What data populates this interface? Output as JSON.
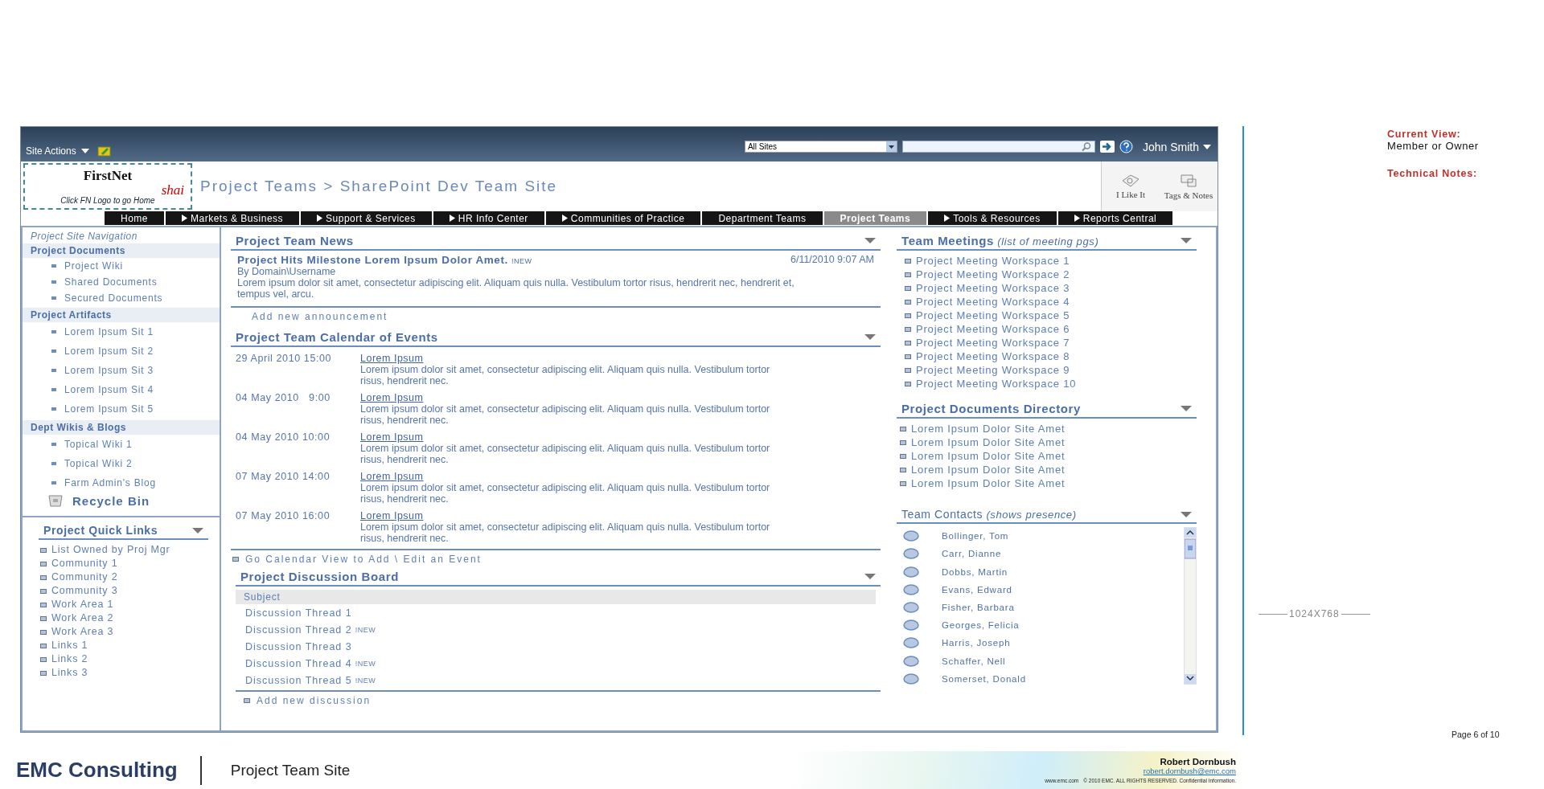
{
  "top_bar": {
    "site_actions": "Site Actions",
    "scope_select": "All Sites",
    "user": "John Smith"
  },
  "logo": {
    "brand": "FirstNet",
    "sub": "shai",
    "caption": "Click FN Logo to go Home"
  },
  "breadcrumb": "Project Teams > SharePoint Dev Team Site",
  "social": [
    {
      "kind": "like",
      "label": "I Like It"
    },
    {
      "kind": "tags",
      "label": "Tags & Notes"
    }
  ],
  "nav_tabs": [
    {
      "label": "Home",
      "arrow": false,
      "selected": false
    },
    {
      "label": "Markets & Business",
      "arrow": true,
      "selected": false
    },
    {
      "label": "Support & Services",
      "arrow": true,
      "selected": false
    },
    {
      "label": "HR Info Center",
      "arrow": true,
      "selected": false
    },
    {
      "label": "Communities of Practice",
      "arrow": true,
      "selected": false
    },
    {
      "label": "Department Teams",
      "arrow": false,
      "selected": false
    },
    {
      "label": "Project Teams",
      "arrow": false,
      "selected": true
    },
    {
      "label": "Tools & Resources",
      "arrow": true,
      "selected": false
    },
    {
      "label": "Reports Central",
      "arrow": true,
      "selected": false
    }
  ],
  "left_nav": {
    "title": "Project Site Navigation",
    "groups": [
      {
        "heading": "Project Documents",
        "items": [
          "Project Wiki",
          "Shared Documents",
          "Secured Documents"
        ]
      },
      {
        "heading": "Project Artifacts",
        "items": [
          "Lorem Ipsum Sit 1",
          "Lorem Ipsum Sit 2",
          "Lorem Ipsum Sit 3",
          "Lorem Ipsum Sit 4",
          "Lorem Ipsum Sit 5"
        ]
      },
      {
        "heading": "Dept Wikis & Blogs",
        "items": [
          "Topical Wiki 1",
          "Topical Wiki 2",
          "Farm Admin's Blog"
        ]
      }
    ],
    "recycle_bin": "Recycle Bin"
  },
  "quick_links": {
    "title": "Project Quick Links",
    "items": [
      "List Owned by Proj Mgr",
      "Community 1",
      "Community 2",
      "Community 3",
      "Work Area 1",
      "Work Area 2",
      "Work Area 3",
      "Links 1",
      "Links 2",
      "Links 3"
    ]
  },
  "news": {
    "title": "Project Team News",
    "items": [
      {
        "headline": "Project Hits Milestone Lorem Ipsum Dolor Amet.",
        "badge": "!NEW",
        "date": "6/11/2010 9:07 AM",
        "author": "By Domain\\Username",
        "body": "Lorem ipsum dolor sit amet, consectetur adipiscing elit. Aliquam quis nulla. Vestibulum tortor risus, hendrerit nec, hendrerit et, tempus vel, arcu."
      }
    ],
    "add": "Add new announcement"
  },
  "calendar": {
    "title": "Project Team Calendar of Events",
    "events": [
      {
        "date": "29 April 2010 15:00",
        "title": "Lorem Ipsum",
        "text": "Lorem ipsum dolor sit amet, consectetur adipiscing elit. Aliquam quis nulla. Vestibulum tortor risus, hendrerit nec."
      },
      {
        "date": "04 May 2010   9:00",
        "title": "Lorem Ipsum",
        "text": "Lorem ipsum dolor sit amet, consectetur adipiscing elit. Aliquam quis nulla. Vestibulum tortor risus, hendrerit nec."
      },
      {
        "date": "04 May 2010 10:00",
        "title": "Lorem Ipsum",
        "text": "Lorem ipsum dolor sit amet, consectetur adipiscing elit. Aliquam quis nulla. Vestibulum tortor risus, hendrerit nec."
      },
      {
        "date": "07 May 2010 14:00",
        "title": "Lorem Ipsum",
        "text": "Lorem ipsum dolor sit amet, consectetur adipiscing elit. Aliquam quis nulla. Vestibulum tortor risus, hendrerit nec."
      },
      {
        "date": "07 May 2010 16:00",
        "title": "Lorem Ipsum",
        "text": "Lorem ipsum dolor sit amet, consectetur adipiscing elit. Aliquam quis nulla. Vestibulum tortor risus, hendrerit nec."
      }
    ],
    "link": "Go Calendar View to Add \\ Edit an Event"
  },
  "discussion": {
    "title": "Project Discussion Board",
    "column": "Subject",
    "threads": [
      {
        "subject": "Discussion Thread 1"
      },
      {
        "subject": "Discussion Thread 2",
        "badge": "!NEW"
      },
      {
        "subject": "Discussion Thread 3"
      },
      {
        "subject": "Discussion Thread 4",
        "badge": "!NEW"
      },
      {
        "subject": "Discussion Thread 5",
        "badge": "!NEW"
      }
    ],
    "add": "Add new discussion"
  },
  "meetings": {
    "title": "Team Meetings",
    "note": "(list of meeting pgs)",
    "items": [
      "Project Meeting Workspace 1",
      "Project Meeting Workspace 2",
      "Project Meeting Workspace 3",
      "Project Meeting Workspace 4",
      "Project Meeting Workspace 5",
      "Project Meeting Workspace 6",
      "Project Meeting Workspace 7",
      "Project Meeting Workspace 8",
      "Project Meeting Workspace 9",
      "Project Meeting Workspace 10"
    ]
  },
  "documents": {
    "title": "Project Documents Directory",
    "items": [
      "Lorem Ipsum Dolor Site Amet",
      "Lorem Ipsum Dolor Site Amet",
      "Lorem Ipsum Dolor Site Amet",
      "Lorem Ipsum Dolor Site Amet",
      "Lorem Ipsum Dolor Site Amet"
    ]
  },
  "contacts": {
    "title": "Team Contacts",
    "note": "(shows presence)",
    "people": [
      "Bollinger, Tom",
      "Carr, Dianne",
      "Dobbs, Martin",
      "Evans, Edward",
      "Fisher, Barbara",
      "Georges, Felicia",
      "Harris, Joseph",
      "Schaffer, Nell",
      "Somerset, Donald"
    ]
  },
  "notes": {
    "view_label": "Current View:",
    "view_value": "Member or Owner",
    "tech_label": "Technical Notes:",
    "resolution": "1024X768",
    "page": "Page 6 of 10"
  },
  "footer": {
    "company": "EMC Consulting",
    "doc_title": "Project Team Site",
    "author": "Robert Dornbush",
    "email": "robert.dornbush@emc.com",
    "site": "www.emc.com",
    "legal": "© 2010 EMC. ALL RIGHTS RESERVED. Confidential Information."
  }
}
